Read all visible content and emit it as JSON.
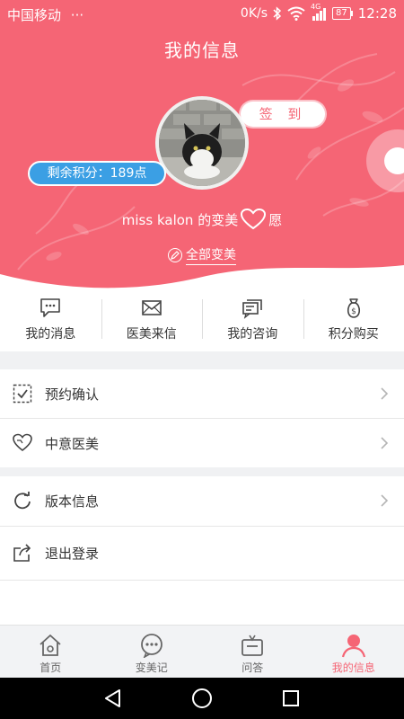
{
  "status_bar": {
    "carrier": "中国移动",
    "dots": "···",
    "speed": "0K/s",
    "network": "4G",
    "battery": "87",
    "time": "12:28"
  },
  "header": {
    "title": "我的信息",
    "signin_label": "签 到",
    "points_label": "剩余积分：189点",
    "wish_prefix": "miss kalon 的变美",
    "wish_suffix": "愿",
    "all_change_label": "全部变美",
    "accent_color": "#f56575",
    "points_color": "#3b9fe4"
  },
  "quick_actions": [
    {
      "label": "我的消息",
      "icon": "message-icon"
    },
    {
      "label": "医美来信",
      "icon": "mail-icon"
    },
    {
      "label": "我的咨询",
      "icon": "consult-icon"
    },
    {
      "label": "积分购买",
      "icon": "money-bag-icon"
    }
  ],
  "menu": [
    {
      "label": "预约确认",
      "icon": "checkbox-icon"
    },
    {
      "label": "中意医美",
      "icon": "heart-icon"
    },
    {
      "label": "版本信息",
      "icon": "refresh-icon"
    },
    {
      "label": "退出登录",
      "icon": "share-exit-icon"
    }
  ],
  "tabs": [
    {
      "label": "首页",
      "icon": "home-icon",
      "active": false
    },
    {
      "label": "变美记",
      "icon": "chat-dots-icon",
      "active": false
    },
    {
      "label": "问答",
      "icon": "qa-icon",
      "active": false
    },
    {
      "label": "我的信息",
      "icon": "person-icon",
      "active": true
    }
  ]
}
